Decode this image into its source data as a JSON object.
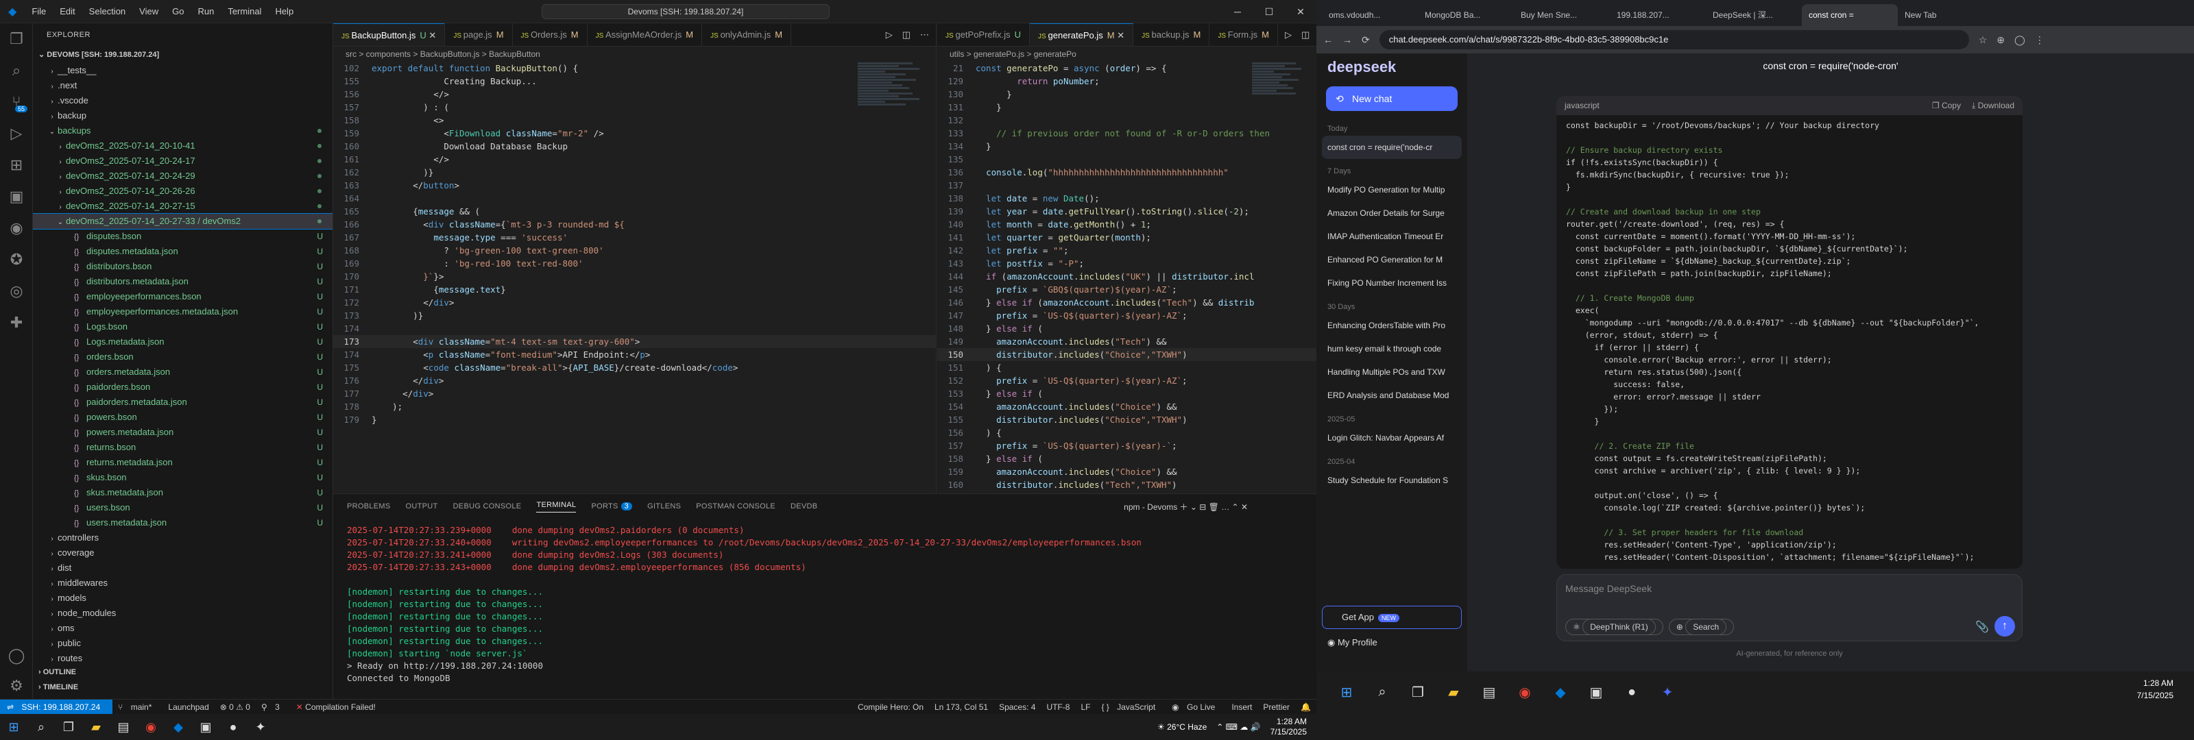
{
  "titlebar": {
    "menus": [
      "File",
      "Edit",
      "Selection",
      "View",
      "Go",
      "Run",
      "Terminal",
      "Help"
    ],
    "command_center": "Devoms [SSH: 199.188.207.24]"
  },
  "explorer": {
    "header": "EXPLORER",
    "root": "DEVOMS [SSH: 199.188.207.24]",
    "items": [
      {
        "l": "__tests__",
        "d": 1,
        "t": "dir"
      },
      {
        "l": ".next",
        "d": 1,
        "t": "dir"
      },
      {
        "l": ".vscode",
        "d": 1,
        "t": "dir"
      },
      {
        "l": "backup",
        "d": 1,
        "t": "dir"
      },
      {
        "l": "backups",
        "d": 1,
        "t": "diropen",
        "g": true
      },
      {
        "l": "devOms2_2025-07-14_20-10-41",
        "d": 2,
        "t": "dir",
        "g": true
      },
      {
        "l": "devOms2_2025-07-14_20-24-17",
        "d": 2,
        "t": "dir",
        "g": true
      },
      {
        "l": "devOms2_2025-07-14_20-24-29",
        "d": 2,
        "t": "dir",
        "g": true
      },
      {
        "l": "devOms2_2025-07-14_20-26-26",
        "d": 2,
        "t": "dir",
        "g": true
      },
      {
        "l": "devOms2_2025-07-14_20-27-15",
        "d": 2,
        "t": "dir",
        "g": true
      },
      {
        "l": "devOms2_2025-07-14_20-27-33 / devOms2",
        "d": 2,
        "t": "diropen",
        "g": true,
        "sel": true
      },
      {
        "l": "disputes.bson",
        "d": 3,
        "t": "file",
        "g": true
      },
      {
        "l": "disputes.metadata.json",
        "d": 3,
        "t": "file",
        "g": true
      },
      {
        "l": "distributors.bson",
        "d": 3,
        "t": "file",
        "g": true
      },
      {
        "l": "distributors.metadata.json",
        "d": 3,
        "t": "file",
        "g": true
      },
      {
        "l": "employeeperformances.bson",
        "d": 3,
        "t": "file",
        "g": true
      },
      {
        "l": "employeeperformances.metadata.json",
        "d": 3,
        "t": "file",
        "g": true
      },
      {
        "l": "Logs.bson",
        "d": 3,
        "t": "file",
        "g": true
      },
      {
        "l": "Logs.metadata.json",
        "d": 3,
        "t": "file",
        "g": true
      },
      {
        "l": "orders.bson",
        "d": 3,
        "t": "file",
        "g": true
      },
      {
        "l": "orders.metadata.json",
        "d": 3,
        "t": "file",
        "g": true
      },
      {
        "l": "paidorders.bson",
        "d": 3,
        "t": "file",
        "g": true
      },
      {
        "l": "paidorders.metadata.json",
        "d": 3,
        "t": "file",
        "g": true
      },
      {
        "l": "powers.bson",
        "d": 3,
        "t": "file",
        "g": true
      },
      {
        "l": "powers.metadata.json",
        "d": 3,
        "t": "file",
        "g": true
      },
      {
        "l": "returns.bson",
        "d": 3,
        "t": "file",
        "g": true
      },
      {
        "l": "returns.metadata.json",
        "d": 3,
        "t": "file",
        "g": true
      },
      {
        "l": "skus.bson",
        "d": 3,
        "t": "file",
        "g": true
      },
      {
        "l": "skus.metadata.json",
        "d": 3,
        "t": "file",
        "g": true
      },
      {
        "l": "users.bson",
        "d": 3,
        "t": "file",
        "g": true
      },
      {
        "l": "users.metadata.json",
        "d": 3,
        "t": "file",
        "g": true
      },
      {
        "l": "controllers",
        "d": 1,
        "t": "dir"
      },
      {
        "l": "coverage",
        "d": 1,
        "t": "dir"
      },
      {
        "l": "dist",
        "d": 1,
        "t": "dir"
      },
      {
        "l": "middlewares",
        "d": 1,
        "t": "dir"
      },
      {
        "l": "models",
        "d": 1,
        "t": "dir"
      },
      {
        "l": "node_modules",
        "d": 1,
        "t": "dir"
      },
      {
        "l": "oms",
        "d": 1,
        "t": "dir"
      },
      {
        "l": "public",
        "d": 1,
        "t": "dir"
      },
      {
        "l": "routes",
        "d": 1,
        "t": "dir"
      }
    ],
    "outline": "OUTLINE",
    "timeline": "TIMELINE"
  },
  "editor1": {
    "tabs": [
      {
        "l": "BackupButton.js",
        "s": "U",
        "active": true
      },
      {
        "l": "page.js",
        "s": "M"
      },
      {
        "l": "Orders.js",
        "s": "M"
      },
      {
        "l": "AssignMeAOrder.js",
        "s": "M"
      },
      {
        "l": "onlyAdmin.js",
        "s": "M"
      }
    ],
    "breadcrumb": "src > components > BackupButton.js > BackupButton",
    "lines": [
      {
        "n": "102",
        "h": "<span class='k'>export default function</span> <span class='f'>BackupButton</span>() {"
      },
      {
        "n": "155",
        "h": "              Creating Backup..."
      },
      {
        "n": "156",
        "h": "            &lt;/&gt;"
      },
      {
        "n": "157",
        "h": "          ) : ("
      },
      {
        "n": "158",
        "h": "            &lt;&gt;"
      },
      {
        "n": "159",
        "h": "              &lt;<span class='tg'>FiDownload</span> <span class='v'>className</span>=<span class='s'>\"mr-2\"</span> /&gt;"
      },
      {
        "n": "160",
        "h": "              Download Database Backup"
      },
      {
        "n": "161",
        "h": "            &lt;/&gt;"
      },
      {
        "n": "162",
        "h": "          )}"
      },
      {
        "n": "163",
        "h": "        &lt;/<span class='k'>button</span>&gt;"
      },
      {
        "n": "164",
        "h": ""
      },
      {
        "n": "165",
        "h": "        {<span class='v'>message</span> &amp;&amp; ("
      },
      {
        "n": "166",
        "h": "          &lt;<span class='k'>div</span> <span class='v'>className</span>={<span class='s'>`mt-3 p-3 rounded-md ${</span>"
      },
      {
        "n": "167",
        "h": "            <span class='v'>message</span>.<span class='v'>type</span> === <span class='s'>'success'</span>"
      },
      {
        "n": "168",
        "h": "              ? <span class='s'>'bg-green-100 text-green-800'</span>"
      },
      {
        "n": "169",
        "h": "              : <span class='s'>'bg-red-100 text-red-800'</span>"
      },
      {
        "n": "170",
        "h": "          <span class='s'>}`</span>}&gt;"
      },
      {
        "n": "171",
        "h": "            {<span class='v'>message</span>.<span class='v'>text</span>}"
      },
      {
        "n": "172",
        "h": "          &lt;/<span class='k'>div</span>&gt;"
      },
      {
        "n": "173",
        "h": "        )}"
      },
      {
        "n": "174",
        "h": ""
      },
      {
        "n": "173",
        "h": "        &lt;<span class='k'>div</span> <span class='v'>className</span>=<span class='s'>\"mt-4 text-sm text-gray-600\"</span>&gt;",
        "cur": true
      },
      {
        "n": "174",
        "h": "          &lt;<span class='k'>p</span> <span class='v'>className</span>=<span class='s'>\"font-medium\"</span>&gt;API Endpoint:&lt;/<span class='k'>p</span>&gt;"
      },
      {
        "n": "175",
        "h": "          &lt;<span class='k'>code</span> <span class='v'>className</span>=<span class='s'>\"break-all\"</span>&gt;{<span class='v'>API_BASE</span>}/create-download&lt;/<span class='k'>code</span>&gt;"
      },
      {
        "n": "176",
        "h": "        &lt;/<span class='k'>div</span>&gt;"
      },
      {
        "n": "177",
        "h": "      &lt;/<span class='k'>div</span>&gt;"
      },
      {
        "n": "178",
        "h": "    );"
      },
      {
        "n": "179",
        "h": "}"
      }
    ]
  },
  "editor2": {
    "tabs": [
      {
        "l": "getPoPrefix.js",
        "s": "U"
      },
      {
        "l": "generatePo.js",
        "s": "M",
        "active": true
      },
      {
        "l": "backup.js",
        "s": "M"
      },
      {
        "l": "Form.js",
        "s": "M"
      }
    ],
    "breadcrumb": "utils > generatePo.js > generatePo",
    "lines": [
      {
        "n": "21",
        "h": "<span class='k'>const</span> <span class='f'>generatePo</span> = <span class='k'>async</span> (<span class='v'>order</span>) =&gt; {"
      },
      {
        "n": "129",
        "h": "        <span class='p'>return</span> <span class='v'>poNumber</span>;"
      },
      {
        "n": "130",
        "h": "      }"
      },
      {
        "n": "131",
        "h": "    }"
      },
      {
        "n": "132",
        "h": ""
      },
      {
        "n": "133",
        "h": "    <span class='c'>// if previous order not found of -R or-D orders then</span>"
      },
      {
        "n": "134",
        "h": "  }"
      },
      {
        "n": "135",
        "h": ""
      },
      {
        "n": "136",
        "h": "  <span class='v'>console</span>.<span class='f'>log</span>(<span class='s'>\"hhhhhhhhhhhhhhhhhhhhhhhhhhhhhhhhh\"</span>"
      },
      {
        "n": "137",
        "h": ""
      },
      {
        "n": "138",
        "h": "  <span class='k'>let</span> <span class='v'>date</span> = <span class='k'>new</span> <span class='tg'>Date</span>();"
      },
      {
        "n": "139",
        "h": "  <span class='k'>let</span> <span class='v'>year</span> = <span class='v'>date</span>.<span class='f'>getFullYear</span>().<span class='f'>toString</span>().<span class='f'>slice</span>(<span class='n'>-2</span>);"
      },
      {
        "n": "140",
        "h": "  <span class='k'>let</span> <span class='v'>month</span> = <span class='v'>date</span>.<span class='f'>getMonth</span>() + <span class='n'>1</span>;"
      },
      {
        "n": "141",
        "h": "  <span class='k'>let</span> <span class='v'>quarter</span> = <span class='f'>getQuarter</span>(<span class='v'>month</span>);"
      },
      {
        "n": "142",
        "h": "  <span class='k'>let</span> <span class='v'>prefix</span> = <span class='s'>\"\"</span>;"
      },
      {
        "n": "143",
        "h": "  <span class='k'>let</span> <span class='v'>postfix</span> = <span class='s'>\"-P\"</span>;"
      },
      {
        "n": "144",
        "h": "  <span class='p'>if</span> (<span class='v'>amazonAccount</span>.<span class='f'>includes</span>(<span class='s'>\"UK\"</span>) || <span class='v'>distributor</span>.<span class='f'>incl</span>"
      },
      {
        "n": "145",
        "h": "    <span class='v'>prefix</span> = <span class='s'>`GBQ$(quarter)$(year)-AZ`</span>;"
      },
      {
        "n": "146",
        "h": "  } <span class='p'>else if</span> (<span class='v'>amazonAccount</span>.<span class='f'>includes</span>(<span class='s'>\"Tech\"</span>) &amp;&amp; <span class='v'>distrib</span>"
      },
      {
        "n": "147",
        "h": "    <span class='v'>prefix</span> = <span class='s'>`US-Q$(quarter)-$(year)-AZ`</span>;"
      },
      {
        "n": "148",
        "h": "  } <span class='p'>else if</span> ("
      },
      {
        "n": "149",
        "h": "    <span class='v'>amazonAccount</span>.<span class='f'>includes</span>(<span class='s'>\"Tech\"</span>) &amp;&amp;"
      },
      {
        "n": "150",
        "h": "    <span class='v'>distributor</span>.<span class='f'>includes</span>(<span class='s'>\"Choice\",\"TXWH\"</span>)",
        "cur": true
      },
      {
        "n": "151",
        "h": "  ) {"
      },
      {
        "n": "152",
        "h": "    <span class='v'>prefix</span> = <span class='s'>`US-Q$(quarter)-$(year)-AZ`</span>;"
      },
      {
        "n": "153",
        "h": "  } <span class='p'>else if</span> ("
      },
      {
        "n": "154",
        "h": "    <span class='v'>amazonAccount</span>.<span class='f'>includes</span>(<span class='s'>\"Choice\"</span>) &amp;&amp;"
      },
      {
        "n": "155",
        "h": "    <span class='v'>distributor</span>.<span class='f'>includes</span>(<span class='s'>\"Choice\",\"TXWH\"</span>)"
      },
      {
        "n": "156",
        "h": "  ) {"
      },
      {
        "n": "157",
        "h": "    <span class='v'>prefix</span> = <span class='s'>`US-Q$(quarter)-$(year)-`</span>;"
      },
      {
        "n": "158",
        "h": "  } <span class='p'>else if</span> ("
      },
      {
        "n": "159",
        "h": "    <span class='v'>amazonAccount</span>.<span class='f'>includes</span>(<span class='s'>\"Choice\"</span>) &amp;&amp;"
      },
      {
        "n": "160",
        "h": "    <span class='v'>distributor</span>.<span class='f'>includes</span>(<span class='s'>\"Tech\",\"TXWH\"</span>)"
      }
    ]
  },
  "panel": {
    "tabs": [
      "PROBLEMS",
      "OUTPUT",
      "DEBUG CONSOLE",
      "TERMINAL",
      "PORTS",
      "GITLENS",
      "POSTMAN CONSOLE",
      "DEVDB"
    ],
    "active": "TERMINAL",
    "ports_count": "3",
    "term_select": "npm - Devoms",
    "terminal": [
      {
        "t": "2025-07-14T20:27:33.239+0000    done dumping devOms2.paidorders (0 documents)",
        "c": "t-red"
      },
      {
        "t": "2025-07-14T20:27:33.240+0000    writing devOms2.employeeperformances to /root/Devoms/backups/devOms2_2025-07-14_20-27-33/devOms2/employeeperformances.bson",
        "c": "t-red"
      },
      {
        "t": "2025-07-14T20:27:33.241+0000    done dumping devOms2.Logs (303 documents)",
        "c": "t-red"
      },
      {
        "t": "2025-07-14T20:27:33.243+0000    done dumping devOms2.employeeperformances (856 documents)",
        "c": "t-red"
      },
      {
        "t": "",
        "c": "t-w"
      },
      {
        "t": "[nodemon] restarting due to changes...",
        "c": "t-green"
      },
      {
        "t": "[nodemon] restarting due to changes...",
        "c": "t-green"
      },
      {
        "t": "[nodemon] restarting due to changes...",
        "c": "t-green"
      },
      {
        "t": "[nodemon] restarting due to changes...",
        "c": "t-green"
      },
      {
        "t": "[nodemon] restarting due to changes...",
        "c": "t-green"
      },
      {
        "t": "[nodemon] starting `node server.js`",
        "c": "t-green"
      },
      {
        "t": "> Ready on http://199.188.207.24:10000",
        "c": "t-w"
      },
      {
        "t": "Connected to MongoDB",
        "c": "t-w"
      }
    ]
  },
  "statusbar": {
    "remote": "SSH: 199.188.207.24",
    "branch": "main*",
    "launchpad": "Launchpad",
    "problems": "⊗ 0 ⚠ 0",
    "ports": "3",
    "compile": "Compilation Failed!",
    "hero": "Compile Hero: On",
    "pos": "Ln 173, Col 51",
    "spaces": "Spaces: 4",
    "enc": "UTF-8",
    "eol": "LF",
    "lang": "JavaScript",
    "golive": "Go Live",
    "insert": "Insert",
    "prettier": "Prettier",
    "weather": "26°C Haze",
    "time": "1:28 AM",
    "date": "7/15/2025"
  },
  "chrome": {
    "tabs": [
      "oms.vdoudh...",
      "MongoDB Ba...",
      "Buy Men Sne...",
      "199.188.207...",
      "DeepSeek | 深...",
      "const cron =",
      "New Tab"
    ],
    "active": 5,
    "url": "chat.deepseek.com/a/chat/s/9987322b-8f9c-4bd0-83c5-389908bc9c1e"
  },
  "deepseek": {
    "logo": "deepseek",
    "new_chat": "New chat",
    "today": "Today",
    "active_chat": "const cron = require('node-cr",
    "sections": [
      {
        "h": "7 Days",
        "items": [
          "Modify PO Generation for Multip",
          "Amazon Order Details for Surge",
          "IMAP Authentication Timeout Er",
          "Enhanced PO Generation for M",
          "Fixing PO Number Increment Iss"
        ]
      },
      {
        "h": "30 Days",
        "items": [
          "Enhancing OrdersTable with Pro",
          "hum kesy email k through code",
          "Handling Multiple POs and TXW",
          "ERD Analysis and Database Mod"
        ]
      },
      {
        "h": "2025-05",
        "items": [
          "Login Glitch: Navbar Appears Af"
        ]
      },
      {
        "h": "2025-04",
        "items": [
          "Study Schedule for Foundation S"
        ]
      }
    ],
    "get_app": "Get App",
    "new_badge": "NEW",
    "profile": "My Profile",
    "chat_title": "const cron = require('node-cron'",
    "code_lang": "javascript",
    "copy": "Copy",
    "download": "Download",
    "code": [
      "const backupDir = '/root/Devoms/backups'; // Your backup directory",
      "",
      "// Ensure backup directory exists",
      "if (!fs.existsSync(backupDir)) {",
      "  fs.mkdirSync(backupDir, { recursive: true });",
      "}",
      "",
      "// Create and download backup in one step",
      "router.get('/create-download', (req, res) => {",
      "  const currentDate = moment().format('YYYY-MM-DD_HH-mm-ss');",
      "  const backupFolder = path.join(backupDir, `${dbName}_${currentDate}`);",
      "  const zipFileName = `${dbName}_backup_${currentDate}.zip`;",
      "  const zipFilePath = path.join(backupDir, zipFileName);",
      "",
      "  // 1. Create MongoDB dump",
      "  exec(",
      "    `mongodump --uri \"mongodb://0.0.0.0:47017\" --db ${dbName} --out \"${backupFolder}\"`,",
      "    (error, stdout, stderr) => {",
      "      if (error || stderr) {",
      "        console.error('Backup error:', error || stderr);",
      "        return res.status(500).json({",
      "          success: false,",
      "          error: error?.message || stderr",
      "        });",
      "      }",
      "",
      "      // 2. Create ZIP file",
      "      const output = fs.createWriteStream(zipFilePath);",
      "      const archive = archiver('zip', { zlib: { level: 9 } });",
      "",
      "      output.on('close', () => {",
      "        console.log(`ZIP created: ${archive.pointer()} bytes`);",
      "",
      "        // 3. Set proper headers for file download",
      "        res.setHeader('Content-Type', 'application/zip');",
      "        res.setHeader('Content-Disposition', `attachment; filename=\"${zipFileName}\"`);"
    ],
    "placeholder": "Message DeepSeek",
    "deepthink": "DeepThink (R1)",
    "search": "Search",
    "disclaimer": "AI-generated, for reference only"
  },
  "taskbar2": {
    "time": "1:28 AM",
    "date": "7/15/2025"
  }
}
